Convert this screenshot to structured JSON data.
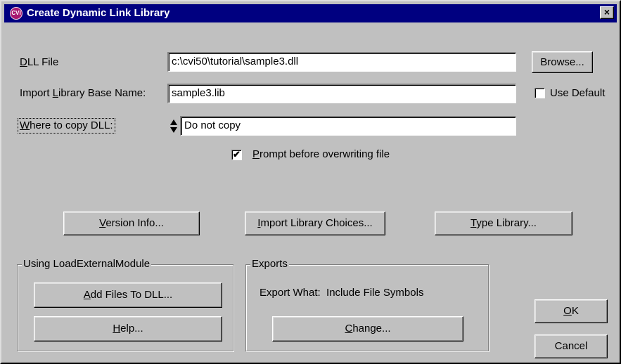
{
  "window": {
    "title": "Create Dynamic Link Library",
    "icon_text": "CVI",
    "close_glyph": "×"
  },
  "form": {
    "dll_file": {
      "label_mnemonic": "D",
      "label_rest": "LL File",
      "value": "c:\\cvi50\\tutorial\\sample3.dll",
      "browse_label": "Browse..."
    },
    "import_library": {
      "label_pre": "Import ",
      "label_mnemonic": "L",
      "label_post": "ibrary Base Name:",
      "value": "sample3.lib",
      "use_default_label": "Use Default",
      "use_default_checked": false
    },
    "copy_dll": {
      "label_mnemonic": "W",
      "label_rest": "here to copy DLL:",
      "value": "Do not copy"
    },
    "prompt_overwrite": {
      "label_mnemonic": "P",
      "label_rest": "rompt before overwriting file",
      "checked": true
    }
  },
  "buttons": {
    "version_info": {
      "mnemonic": "V",
      "rest": "ersion Info..."
    },
    "import_choices": {
      "mnemonic": "I",
      "rest": "mport Library Choices..."
    },
    "type_library": {
      "mnemonic": "T",
      "rest": "ype Library..."
    }
  },
  "load_external_group": {
    "title": "Using LoadExternalModule",
    "add_files": {
      "mnemonic": "A",
      "rest": "dd Files To DLL..."
    },
    "help": {
      "mnemonic": "H",
      "rest": "elp..."
    }
  },
  "exports_group": {
    "title": "Exports",
    "export_what_label": "Export What:",
    "export_what_value": "Include File Symbols",
    "change": {
      "mnemonic": "C",
      "rest": "hange..."
    }
  },
  "dialog_buttons": {
    "ok": {
      "mnemonic": "O",
      "rest": "K"
    },
    "cancel": "Cancel"
  }
}
